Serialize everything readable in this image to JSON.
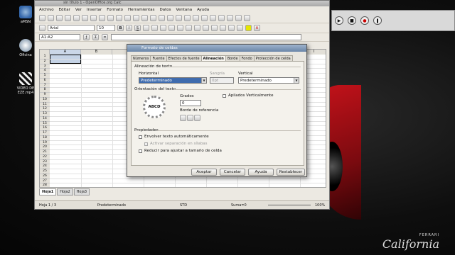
{
  "desktop": {
    "icons": [
      {
        "label": "aMSN",
        "name": "amsn"
      },
      {
        "label": "Oficina",
        "name": "oficina"
      },
      {
        "label": "VIDEO DE EZE.mp4",
        "name": "video"
      }
    ],
    "brand": {
      "line1": "FERRARI",
      "line2": "California"
    }
  },
  "calc": {
    "title": "sin título 1 - OpenOffice.org Calc",
    "menu": [
      "Archivo",
      "Editar",
      "Ver",
      "Insertar",
      "Formato",
      "Herramientas",
      "Datos",
      "Ventana",
      "Ayuda"
    ],
    "font_name": "Arial",
    "font_size": "10",
    "name_box": "A1:A2",
    "columns": [
      "A",
      "B",
      "C",
      "D",
      "E",
      "F",
      "G",
      "H",
      "I"
    ],
    "rows": [
      "1",
      "2",
      "3",
      "4",
      "5",
      "6",
      "7",
      "8",
      "9",
      "10",
      "11",
      "12",
      "13",
      "14",
      "15",
      "16",
      "17",
      "18",
      "19",
      "20",
      "21",
      "22",
      "23",
      "24",
      "25",
      "26",
      "27",
      "28"
    ],
    "sheets": [
      "Hoja1",
      "Hoja2",
      "Hoja3"
    ],
    "status": {
      "sheet": "Hoja 1 / 3",
      "style": "Predeterminado",
      "mode": "STD",
      "sum": "Suma=0",
      "zoom": "100%"
    }
  },
  "dialog": {
    "title": "Formato de celdas",
    "tabs": [
      "Números",
      "Fuente",
      "Efectos de fuente",
      "Alineación",
      "Borde",
      "Fondo",
      "Protección de celda"
    ],
    "active_tab": "Alineación",
    "section_align": "Alineación de texto",
    "horizontal_label": "Horizontal",
    "horizontal_value": "Predeterminado",
    "indent_label": "Sangría",
    "indent_value": "0pt",
    "vertical_label": "Vertical",
    "vertical_value": "Predeterminado",
    "section_orient": "Orientación del texto",
    "degrees_label": "Grados",
    "degrees_value": "0",
    "dial_text": "ABCD",
    "stacked_label": "Apilados Verticalmente",
    "ref_edge_label": "Borde de referencia",
    "section_props": "Propiedades",
    "wrap_label": "Envolver texto automáticamente",
    "hyphen_label": "Activar separación en sílabas",
    "shrink_label": "Reducir para ajustar a tamaño de celda",
    "buttons": {
      "ok": "Aceptar",
      "cancel": "Cancelar",
      "help": "Ayuda",
      "reset": "Restablecer"
    }
  },
  "recorder": {
    "buttons": [
      "play",
      "stop",
      "record",
      "pause"
    ]
  }
}
